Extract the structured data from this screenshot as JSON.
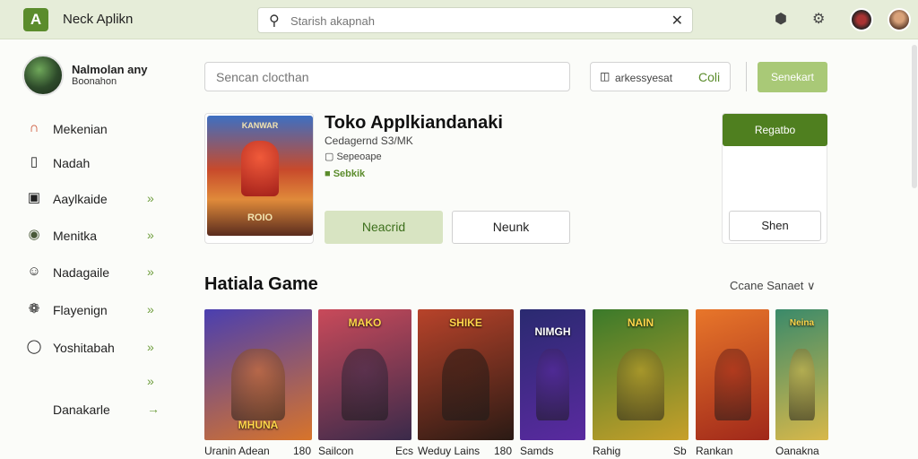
{
  "header": {
    "logo": "A",
    "app_name": "Neck Aplikn",
    "search_placeholder": "Starish akapnah",
    "icons": [
      "search-icon",
      "close-icon",
      "notification-icon",
      "settings-icon",
      "avatar",
      "avatar"
    ]
  },
  "profile": {
    "name": "Nalmolan any",
    "subtitle": "Boonahon"
  },
  "sidebar": {
    "items": [
      {
        "label": "Mekenian",
        "icon": "bookmark-icon",
        "chevron": ""
      },
      {
        "label": "Nadah",
        "icon": "page-icon",
        "chevron": ""
      },
      {
        "label": "Aaylkaide",
        "icon": "monitor-icon",
        "chevron": "»"
      },
      {
        "label": "Menitka",
        "icon": "target-icon",
        "chevron": "»"
      },
      {
        "label": "Nadagaile",
        "icon": "smile-icon",
        "chevron": "»"
      },
      {
        "label": "Flayenign",
        "icon": "leaf-icon",
        "chevron": "»"
      },
      {
        "label": "Yoshitabah",
        "icon": "ring-icon",
        "chevron": "»"
      },
      {
        "label": "",
        "icon": "",
        "chevron": "»"
      },
      {
        "label": "Danakarle",
        "icon": "",
        "chevron": "→"
      }
    ]
  },
  "filter_bar": {
    "placeholder": "Sencan clocthan",
    "category_label": "arkessyesat",
    "category_button": "Coli",
    "send_button": "Senekart"
  },
  "app": {
    "cover_top": "KANWAR",
    "cover_bottom": "ROIO",
    "title": "Toko Applkiandanaki",
    "developer": "Cedagernd S3/MK",
    "category": "Sepeoape",
    "status": "Sebkik",
    "btn_primary": "Neacrid",
    "btn_secondary": "Neunk",
    "install": "Regatbo",
    "share": "Shen"
  },
  "section": {
    "title": "Hatiala Game",
    "sort_label": "Ccane Sanaet"
  },
  "games": [
    {
      "name": "Uranin Adean",
      "num": "180",
      "caption": "MHUNA",
      "color1": "#4a3fb0",
      "color2": "#d8742a"
    },
    {
      "name": "Sailcon",
      "num": "Ecs",
      "caption": "MAKO",
      "color1": "#c94a5a",
      "color2": "#3a2a4a"
    },
    {
      "name": "Weduy Lains",
      "num": "180",
      "caption": "SHIKE",
      "color1": "#b8432a",
      "color2": "#2a1a14"
    },
    {
      "name": "Samds",
      "num": "",
      "caption": "NIMGH",
      "color1": "#2a2a70",
      "color2": "#5a2aa0"
    },
    {
      "name": "Rahig",
      "num": "Sb",
      "caption": "NAIN",
      "color1": "#3a7a2a",
      "color2": "#c8a02a"
    },
    {
      "name": "Rankan",
      "num": "",
      "caption": "",
      "color1": "#e8762a",
      "color2": "#a0281a"
    },
    {
      "name": "Oanakna",
      "num": "",
      "caption": "Neina",
      "color1": "#3a8a6a",
      "color2": "#d8b84a"
    }
  ]
}
